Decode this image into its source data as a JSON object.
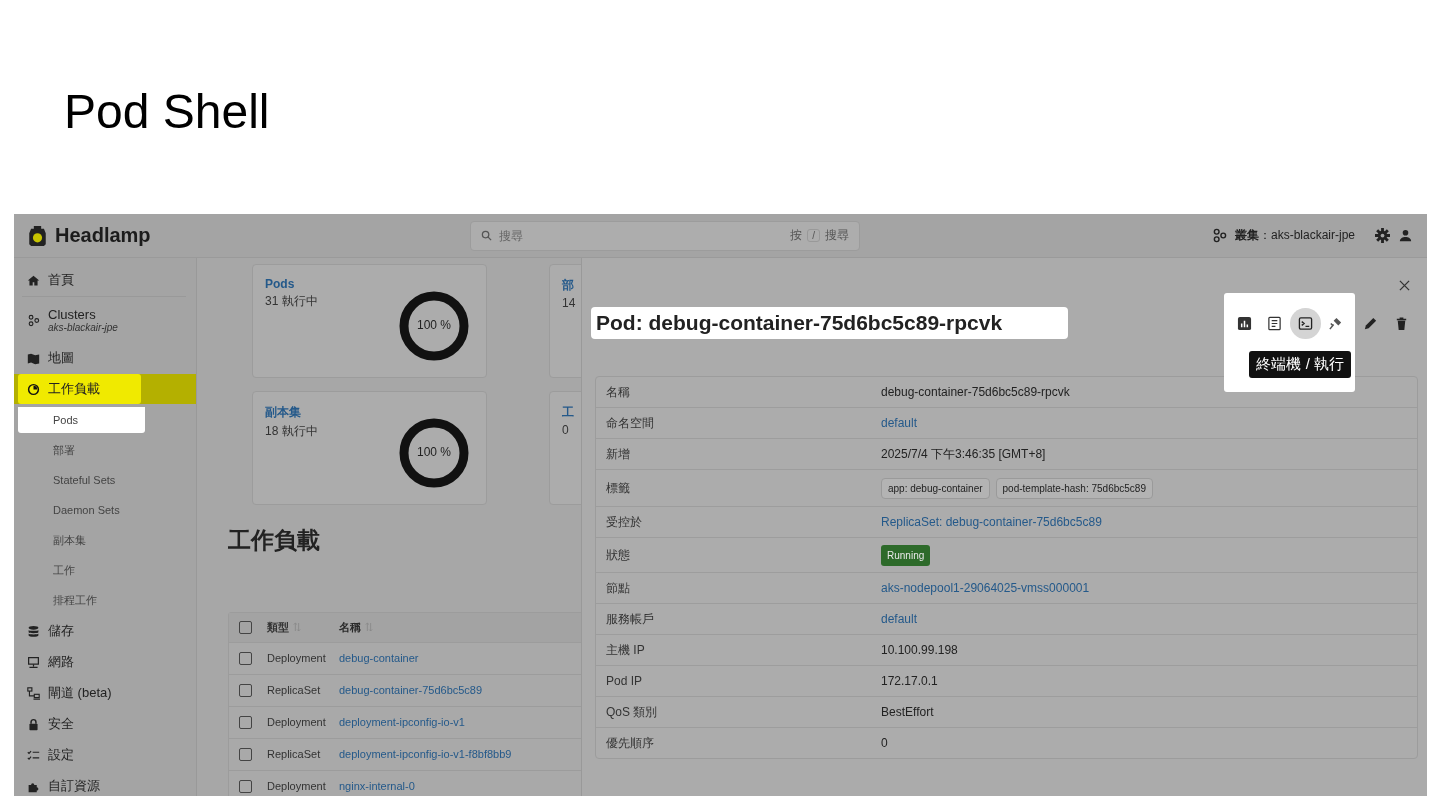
{
  "slide_title": "Pod Shell",
  "app": {
    "name": "Headlamp",
    "search": {
      "placeholder": "搜尋",
      "hint_prefix": "按",
      "hint_key": "/",
      "hint_suffix": "搜尋"
    },
    "cluster": {
      "label": "叢集",
      "value": "：aks-blackair-jpe"
    }
  },
  "sidebar": {
    "items": [
      {
        "label": "首頁",
        "selected": false,
        "highlighted": false
      },
      {
        "label": "Clusters",
        "subtitle": "aks-blackair-jpe",
        "selected": false,
        "highlighted": false
      },
      {
        "label": "地圖",
        "selected": false,
        "highlighted": false
      },
      {
        "label": "工作負載",
        "selected": true,
        "highlighted": true,
        "children": [
          {
            "label": "Pods",
            "selected": false,
            "highlighted": true
          },
          {
            "label": "部署",
            "selected": false,
            "highlighted": false
          },
          {
            "label": "Stateful Sets",
            "selected": false,
            "highlighted": false
          },
          {
            "label": "Daemon Sets",
            "selected": false,
            "highlighted": false
          },
          {
            "label": "副本集",
            "selected": false,
            "highlighted": false
          },
          {
            "label": "工作",
            "selected": false,
            "highlighted": false
          },
          {
            "label": "排程工作",
            "selected": false,
            "highlighted": false
          }
        ]
      },
      {
        "label": "儲存",
        "selected": false,
        "highlighted": false
      },
      {
        "label": "網路",
        "selected": false,
        "highlighted": false
      },
      {
        "label": "閘道 (beta)",
        "selected": false,
        "highlighted": false
      },
      {
        "label": "安全",
        "selected": false,
        "highlighted": false
      },
      {
        "label": "設定",
        "selected": false,
        "highlighted": false
      },
      {
        "label": "自訂資源",
        "selected": false,
        "highlighted": false
      }
    ]
  },
  "cards": [
    {
      "title": "Pods",
      "subtitle": "31 執行中",
      "ring_label": "100 %",
      "level": 1
    },
    {
      "title": "部",
      "subtitle": "14"
    },
    {
      "title": "副本集",
      "subtitle": "18 執行中",
      "ring_label": "100 %",
      "level": 1
    },
    {
      "title": "工",
      "subtitle": "0"
    }
  ],
  "heading": "工作負載",
  "table": {
    "select_all_checked": false,
    "columns": [
      "類型",
      "名稱"
    ],
    "rows": [
      {
        "type": "Deployment",
        "name": "debug-container",
        "checked": false
      },
      {
        "type": "ReplicaSet",
        "name": "debug-container-75d6bc5c89",
        "checked": false
      },
      {
        "type": "Deployment",
        "name": "deployment-ipconfig-io-v1",
        "checked": false
      },
      {
        "type": "ReplicaSet",
        "name": "deployment-ipconfig-io-v1-f8bf8bb9",
        "checked": false
      },
      {
        "type": "Deployment",
        "name": "nginx-internal-0",
        "checked": false
      }
    ]
  },
  "drawer": {
    "title": "Pod: debug-container-75d6bc5c89-rpcvk",
    "title_highlighted": true,
    "actions": [
      {
        "kind": "metrics",
        "selected": false,
        "highlighted": true
      },
      {
        "kind": "logs",
        "selected": false,
        "highlighted": true
      },
      {
        "kind": "terminal",
        "selected": true,
        "highlighted": true
      },
      {
        "kind": "attach",
        "selected": false,
        "highlighted": true
      },
      {
        "kind": "edit",
        "selected": false,
        "highlighted": false
      },
      {
        "kind": "delete",
        "selected": false,
        "highlighted": false
      }
    ],
    "tooltip": "終端機 / 執行",
    "details": [
      {
        "label": "名稱",
        "kind": "text",
        "value": "debug-container-75d6bc5c89-rpcvk"
      },
      {
        "label": "命名空間",
        "kind": "link",
        "value": "default"
      },
      {
        "label": "新增",
        "kind": "text",
        "value": "2025/7/4 下午3:46:35 [GMT+8]"
      },
      {
        "label": "標籤",
        "kind": "chips",
        "chips": [
          "app: debug-container",
          "pod-template-hash: 75d6bc5c89"
        ]
      },
      {
        "label": "受控於",
        "kind": "link",
        "value": "ReplicaSet: debug-container-75d6bc5c89"
      },
      {
        "label": "狀態",
        "kind": "status",
        "value": "Running"
      },
      {
        "label": "節點",
        "kind": "link",
        "value": "aks-nodepool1-29064025-vmss000001"
      },
      {
        "label": "服務帳戶",
        "kind": "link",
        "value": "default"
      },
      {
        "label": "主機 IP",
        "kind": "text",
        "value": "10.100.99.198"
      },
      {
        "label": "Pod IP",
        "kind": "text",
        "value": "172.17.0.1"
      },
      {
        "label": "QoS 類別",
        "kind": "text",
        "value": "BestEffort"
      },
      {
        "label": "優先順序",
        "kind": "text",
        "value": "0"
      }
    ]
  }
}
